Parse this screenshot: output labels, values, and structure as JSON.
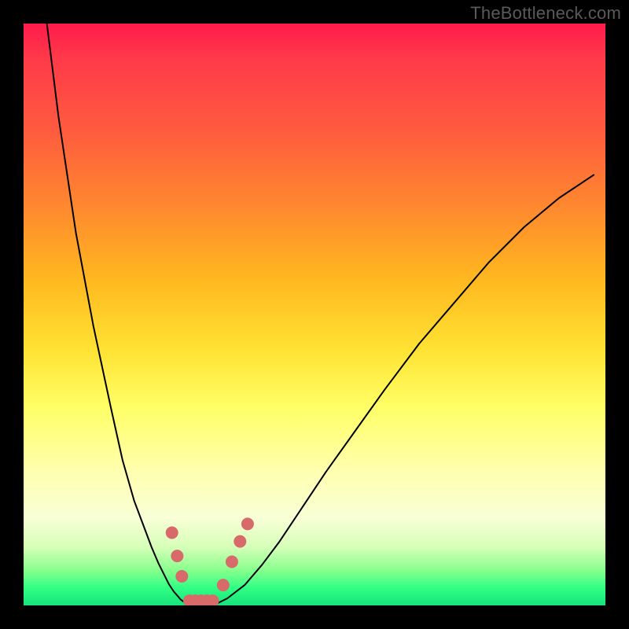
{
  "watermark": "TheBottleneck.com",
  "chart_data": {
    "type": "line",
    "title": "",
    "xlabel": "",
    "ylabel": "",
    "xlim": [
      0,
      100
    ],
    "ylim": [
      0,
      100
    ],
    "grid": false,
    "legend": false,
    "gradient_stops_pct": {
      "0": "#ff1a4b",
      "18": "#ff5a3f",
      "44": "#ffb81f",
      "66": "#ffff66",
      "85": "#f8ffd6",
      "97": "#31ff85",
      "100": "#16e47a"
    },
    "series": [
      {
        "name": "left-branch",
        "x": [
          4,
          6,
          9,
          12,
          15,
          17,
          19,
          20.5,
          22,
          23.2,
          24.2,
          25,
          25.8,
          26.5,
          27,
          27.7,
          28.5
        ],
        "y": [
          100,
          84,
          64,
          48,
          34,
          25,
          18,
          14,
          10,
          7.2,
          5.2,
          3.6,
          2.4,
          1.6,
          1.0,
          0.5,
          0.2
        ],
        "stroke": "#000000",
        "stroke_width": 2
      },
      {
        "name": "right-branch",
        "x": [
          33,
          35,
          38,
          41,
          44,
          48,
          52,
          57,
          62,
          68,
          74,
          80,
          86,
          92,
          98
        ],
        "y": [
          0.2,
          1.2,
          3.5,
          7.0,
          11,
          17,
          23,
          30,
          37,
          45,
          52,
          59,
          65,
          70,
          74
        ],
        "stroke": "#000000",
        "stroke_width": 2
      },
      {
        "name": "valley-floor",
        "x": [
          28.5,
          33
        ],
        "y": [
          0.2,
          0.2
        ],
        "stroke": "#000000",
        "stroke_width": 2
      }
    ],
    "markers": [
      {
        "group": "left-dots",
        "color": "#d86a6a",
        "points": [
          [
            25.5,
            12.5
          ],
          [
            26.4,
            8.5
          ],
          [
            27.2,
            5.0
          ]
        ],
        "r": 8
      },
      {
        "group": "floor-dots",
        "color": "#d86a6a",
        "points": [
          [
            28.5,
            0.8
          ],
          [
            29.5,
            0.8
          ],
          [
            30.5,
            0.8
          ],
          [
            31.5,
            0.8
          ],
          [
            32.5,
            0.8
          ]
        ],
        "r": 8
      },
      {
        "group": "right-dots",
        "color": "#d86a6a",
        "points": [
          [
            34.3,
            3.5
          ],
          [
            35.8,
            7.5
          ],
          [
            37.2,
            11.0
          ],
          [
            38.5,
            14.0
          ]
        ],
        "r": 8
      }
    ]
  }
}
